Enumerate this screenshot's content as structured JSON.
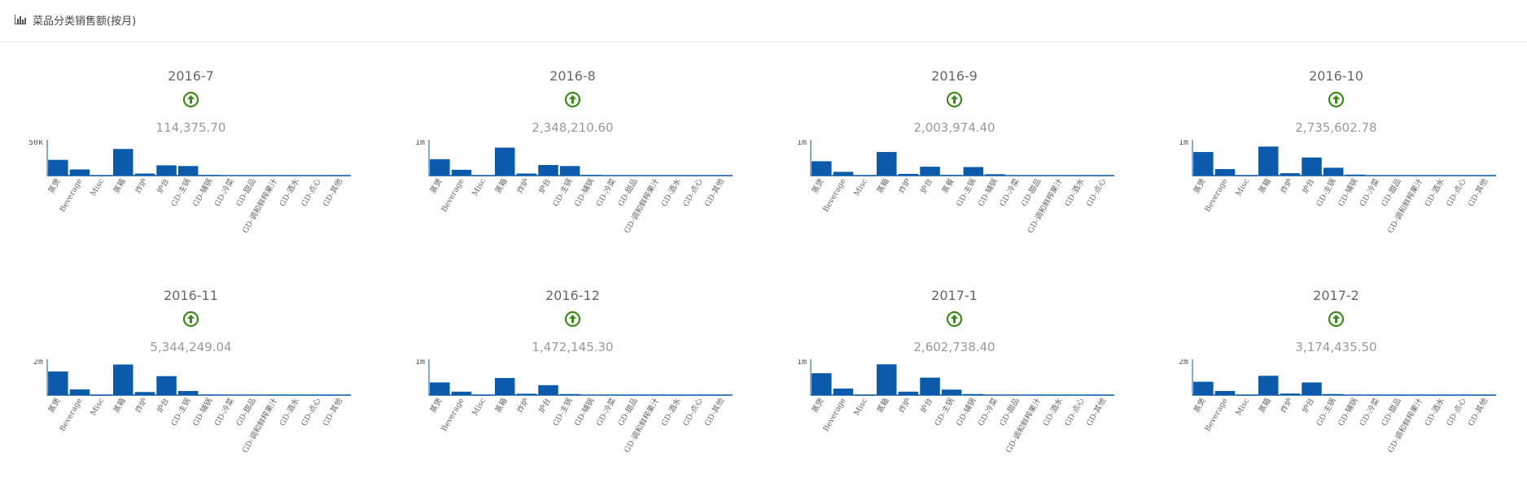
{
  "header": {
    "title": "菜品分类销售额(按月)",
    "icon": "bar-chart-icon"
  },
  "colors": {
    "bar": "#0b5aab",
    "axis": "#0b5aab",
    "arrow": "#3b8a1a",
    "header_border": "#e6e6e6"
  },
  "categories": [
    "蒸煲",
    "Beverage",
    "Misc",
    "蒸箱",
    "炸炉",
    "炉台",
    "GD-主锅",
    "GD-辅锅",
    "GD-冷菜",
    "GD-甜品",
    "GD-调和鲜榨果汁",
    "GD-酒水",
    "GD-点心",
    "GD-其他"
  ],
  "chart_data": [
    {
      "type": "bar",
      "title": "2016-7",
      "total": "114,375.70",
      "trend": "up",
      "ytick": "50k",
      "ylim": [
        0,
        50000
      ],
      "categories": [
        "蒸煲",
        "Beverage",
        "Misc",
        "蒸箱",
        "炸炉",
        "炉台",
        "GD-主锅",
        "GD-辅锅",
        "GD-冷菜",
        "GD-甜品",
        "GD-调和鲜榨果汁",
        "GD-酒水",
        "GD-点心",
        "GD-其他"
      ],
      "values": [
        23000,
        9000,
        0,
        39000,
        3000,
        15000,
        14000,
        1000,
        500,
        300,
        300,
        300,
        300,
        200
      ]
    },
    {
      "type": "bar",
      "title": "2016-8",
      "total": "2,348,210.60",
      "trend": "up",
      "ytick": "1m",
      "ylim": [
        0,
        1000000
      ],
      "categories": [
        "蒸煲",
        "Beverage",
        "Misc",
        "蒸箱",
        "炸炉",
        "炉台",
        "GD-主锅",
        "GD-辅锅",
        "GD-冷菜",
        "GD-甜品",
        "GD-调和鲜榨果汁",
        "GD-酒水",
        "GD-点心",
        "GD-其他"
      ],
      "values": [
        480000,
        170000,
        0,
        820000,
        60000,
        310000,
        280000,
        20000,
        10000,
        8000,
        6000,
        6000,
        6000,
        5000
      ]
    },
    {
      "type": "bar",
      "title": "2016-9",
      "total": "2,003,974.40",
      "trend": "up",
      "ytick": "1m",
      "ylim": [
        0,
        1000000
      ],
      "categories": [
        "蒸煲",
        "Beverage",
        "Misc",
        "蒸箱",
        "炸炉",
        "炉台",
        "蒸餐",
        "GD-主锅",
        "GD-辅锅",
        "GD-冷菜",
        "GD-甜品",
        "GD-调和鲜榨果汁",
        "GD-酒水",
        "GD-点心"
      ],
      "values": [
        420000,
        110000,
        0,
        690000,
        50000,
        260000,
        20000,
        250000,
        40000,
        8000,
        6000,
        6000,
        5000,
        5000
      ]
    },
    {
      "type": "bar",
      "title": "2016-10",
      "total": "2,735,602.78",
      "trend": "up",
      "ytick": "1m",
      "ylim": [
        0,
        1000000
      ],
      "categories": [
        "蒸煲",
        "Beverage",
        "Misc",
        "蒸箱",
        "炸炉",
        "炉台",
        "GD-主锅",
        "GD-辅锅",
        "GD-冷菜",
        "GD-甜品",
        "GD-调和鲜榨果汁",
        "GD-酒水",
        "GD-点心",
        "GD-其他"
      ],
      "values": [
        690000,
        190000,
        0,
        850000,
        70000,
        530000,
        230000,
        30000,
        10000,
        8000,
        6000,
        6000,
        6000,
        5000
      ]
    },
    {
      "type": "bar",
      "title": "2016-11",
      "total": "5,344,249.04",
      "trend": "up",
      "ytick": "2m",
      "ylim": [
        0,
        2000000
      ],
      "categories": [
        "蒸煲",
        "Beverage",
        "Misc",
        "蒸箱",
        "炸炉",
        "炉台",
        "GD-主锅",
        "GD-辅锅",
        "GD-冷菜",
        "GD-甜品",
        "GD-调和鲜榨果汁",
        "GD-酒水",
        "GD-点心",
        "GD-其他"
      ],
      "values": [
        1380000,
        330000,
        0,
        1790000,
        180000,
        1110000,
        240000,
        30000,
        20000,
        15000,
        12000,
        12000,
        12000,
        10000
      ]
    },
    {
      "type": "bar",
      "title": "2016-12",
      "total": "1,472,145.30",
      "trend": "up",
      "ytick": "1m",
      "ylim": [
        0,
        1000000
      ],
      "categories": [
        "蒸煲",
        "Beverage",
        "Misc",
        "蒸箱",
        "炸炉",
        "炉台",
        "GD-主锅",
        "GD-辅锅",
        "GD-冷菜",
        "GD-甜品",
        "GD-调和鲜榨果汁",
        "GD-酒水",
        "GD-点心",
        "GD-其他"
      ],
      "values": [
        370000,
        100000,
        0,
        500000,
        40000,
        290000,
        30000,
        10000,
        6000,
        5000,
        5000,
        5000,
        5000,
        4000
      ]
    },
    {
      "type": "bar",
      "title": "2017-1",
      "total": "2,602,738.40",
      "trend": "up",
      "ytick": "1m",
      "ylim": [
        0,
        1000000
      ],
      "categories": [
        "蒸煲",
        "Beverage",
        "Misc",
        "蒸箱",
        "炸炉",
        "炉台",
        "GD-主锅",
        "GD-辅锅",
        "GD-冷菜",
        "GD-甜品",
        "GD-调和鲜榨果汁",
        "GD-酒水",
        "GD-点心",
        "GD-其他"
      ],
      "values": [
        640000,
        190000,
        0,
        900000,
        100000,
        510000,
        160000,
        30000,
        10000,
        8000,
        6000,
        6000,
        6000,
        5000
      ]
    },
    {
      "type": "bar",
      "title": "2017-2",
      "total": "3,174,435.50",
      "trend": "up",
      "ytick": "2m",
      "ylim": [
        0,
        2000000
      ],
      "categories": [
        "蒸煲",
        "Beverage",
        "Misc",
        "蒸箱",
        "炸炉",
        "炉台",
        "GD-主锅",
        "GD-辅锅",
        "GD-冷菜",
        "GD-甜品",
        "GD-调和鲜榨果汁",
        "GD-酒水",
        "GD-点心",
        "GD-其他"
      ],
      "values": [
        780000,
        240000,
        0,
        1130000,
        90000,
        740000,
        60000,
        20000,
        12000,
        10000,
        10000,
        10000,
        10000,
        8000
      ]
    }
  ]
}
